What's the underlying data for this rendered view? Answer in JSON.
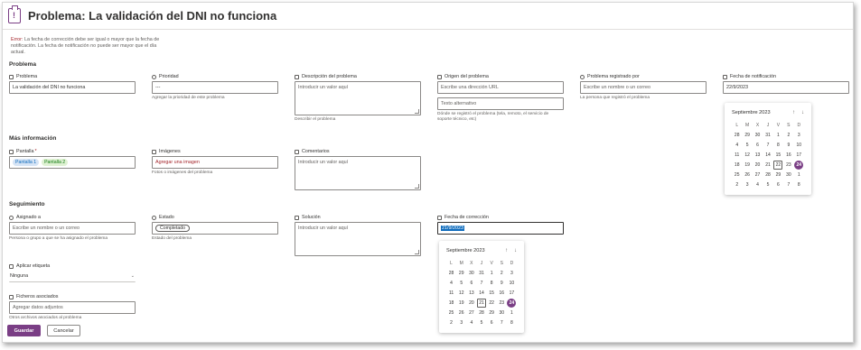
{
  "header": {
    "title": "Problema: La validación del DNI no funciona"
  },
  "error": {
    "prefix": "Error:",
    "message": "La fecha de corrección debe ser igual o mayor que la fecha de notificación. La fecha de notificación no puede ser mayor que el día actual."
  },
  "sections": {
    "problema": "Problema",
    "mas_info": "Más información",
    "seguimiento": "Seguimiento"
  },
  "fields": {
    "problema": {
      "label": "Problema",
      "value": "La validación del DNI no funciona"
    },
    "prioridad": {
      "label": "Prioridad",
      "value": "---",
      "hint": "Agregar la prioridad de este problema"
    },
    "descripcion": {
      "label": "Descripción del problema",
      "placeholder": "Introducir un valor aquí",
      "hint": "Describir el problema"
    },
    "origen": {
      "label": "Origen del problema",
      "placeholder": "Escribe una dirección URL",
      "placeholder2": "Texto alternativo",
      "hint": "Dónde se registró el problema (tela, remoto, el servicio de soporte técnico, etc)"
    },
    "registrado": {
      "label": "Problema registrado por",
      "placeholder": "Escribe un nombre o un correo",
      "hint": "La persona que registró el problema"
    },
    "notificacion": {
      "label": "Fecha de notificación",
      "value": "22/9/2023"
    },
    "pantalla": {
      "label": "Pantalla",
      "required": "*",
      "tags": [
        "Pantalla 1",
        "Pantalla 2"
      ]
    },
    "imagenes": {
      "label": "Imágenes",
      "placeholder": "Agregar una imagen",
      "hint": "Fotos o imágenes del problema"
    },
    "comentarios": {
      "label": "Comentarios",
      "placeholder": "Introducir un valor aquí"
    },
    "asignado": {
      "label": "Asignado a",
      "placeholder": "Escribe un nombre o un correo",
      "hint": "Persona o grupo a que se ha asignado el problema"
    },
    "estado": {
      "label": "Estado",
      "value": "Completado",
      "hint": "Estado del problema"
    },
    "solucion": {
      "label": "Solución",
      "placeholder": "Introducir un valor aquí"
    },
    "correccion": {
      "label": "Fecha de corrección",
      "value": "21/9/2023"
    },
    "etiqueta": {
      "label": "Aplicar etiqueta",
      "value": "Ninguna"
    },
    "ficheros": {
      "label": "Ficheros asociados",
      "placeholder": "Agregar datos adjuntos",
      "hint": "Otros archivos asociados al problema"
    }
  },
  "calendar": {
    "month": "Septiembre 2023",
    "up": "↑",
    "down": "↓",
    "weekdays": [
      "L",
      "M",
      "X",
      "J",
      "V",
      "S",
      "D"
    ],
    "days": [
      [
        "28",
        "29",
        "30",
        "31",
        "1",
        "2",
        "3"
      ],
      [
        "4",
        "5",
        "6",
        "7",
        "8",
        "9",
        "10"
      ],
      [
        "11",
        "12",
        "13",
        "14",
        "15",
        "16",
        "17"
      ],
      [
        "18",
        "19",
        "20",
        "21",
        "22",
        "23",
        "24"
      ],
      [
        "25",
        "26",
        "27",
        "28",
        "29",
        "30",
        "1"
      ],
      [
        "2",
        "3",
        "4",
        "5",
        "6",
        "7",
        "8"
      ]
    ]
  },
  "buttons": {
    "save": "Guardar",
    "cancel": "Cancelar"
  },
  "colors": {
    "accent": "#7a3e85",
    "error": "#a4262c",
    "selection": "#0f6cbd"
  }
}
